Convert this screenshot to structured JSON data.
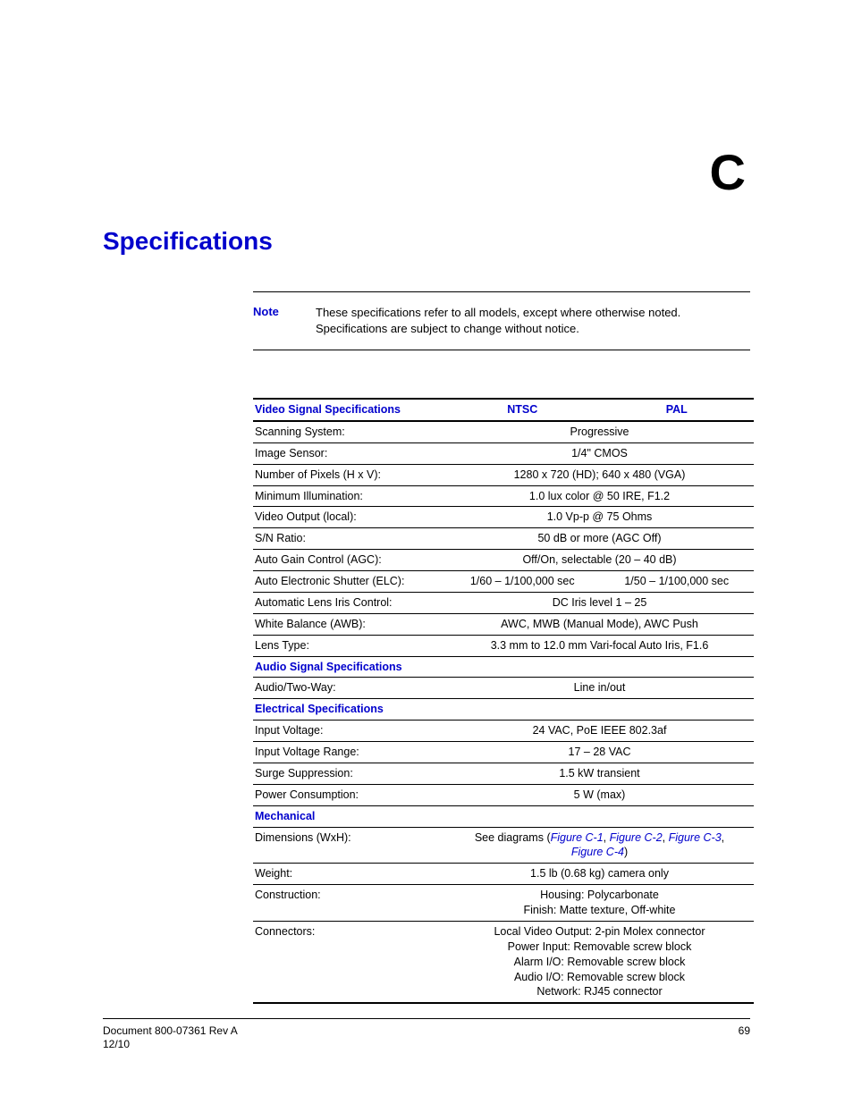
{
  "appendix_letter": "C",
  "title": "Specifications",
  "note": {
    "label": "Note",
    "text": "These specifications refer to all models, except where otherwise noted. Specifications are subject to change without notice."
  },
  "table": {
    "header": {
      "col1": "Video Signal Specifications",
      "col2": "NTSC",
      "col3": "PAL"
    },
    "rows": {
      "scanning_system": {
        "label": "Scanning System:",
        "value": "Progressive"
      },
      "image_sensor": {
        "label": "Image Sensor:",
        "value": "1/4\" CMOS"
      },
      "num_pixels": {
        "label": "Number of Pixels (H x V):",
        "value": "1280 x 720 (HD); 640 x 480 (VGA)"
      },
      "min_illum": {
        "label": "Minimum Illumination:",
        "value": "1.0 lux color @ 50 IRE, F1.2"
      },
      "video_output": {
        "label": "Video Output (local):",
        "value": "1.0 Vp-p @ 75 Ohms"
      },
      "sn_ratio": {
        "label": "S/N Ratio:",
        "value": "50 dB or more (AGC Off)"
      },
      "agc": {
        "label": "Auto Gain Control (AGC):",
        "value": "Off/On, selectable (20 – 40 dB)"
      },
      "elc": {
        "label": "Auto Electronic Shutter (ELC):",
        "ntsc": "1/60 – 1/100,000 sec",
        "pal": "1/50 – 1/100,000 sec"
      },
      "iris": {
        "label": "Automatic Lens Iris Control:",
        "value": "DC Iris level 1 – 25"
      },
      "awb": {
        "label": "White Balance (AWB):",
        "value": "AWC, MWB (Manual Mode), AWC Push"
      },
      "lens_type": {
        "label": "Lens Type:",
        "value": "3.3 mm to 12.0 mm Vari-focal Auto Iris, F1.6"
      },
      "audio_header": "Audio Signal Specifications",
      "audio_two_way": {
        "label": "Audio/Two-Way:",
        "value": "Line in/out"
      },
      "electrical_header": "Electrical Specifications",
      "input_voltage": {
        "label": "Input Voltage:",
        "value": "24 VAC, PoE IEEE 802.3af"
      },
      "input_voltage_range": {
        "label": "Input Voltage Range:",
        "value": "17 – 28 VAC"
      },
      "surge": {
        "label": "Surge Suppression:",
        "value": "1.5 kW transient"
      },
      "power": {
        "label": "Power Consumption:",
        "value": "5 W (max)"
      },
      "mechanical_header": "Mechanical",
      "dimensions": {
        "label": "Dimensions (WxH):",
        "prefix": "See diagrams (",
        "links": {
          "c1": "Figure C-1",
          "c2": "Figure C-2",
          "c3": "Figure C-3",
          "c4": "Figure C-4"
        },
        "sep": ", ",
        "suffix": ")"
      },
      "weight": {
        "label": "Weight:",
        "value": "1.5 lb (0.68 kg) camera only"
      },
      "construction": {
        "label": "Construction:",
        "line1": "Housing: Polycarbonate",
        "line2": "Finish: Matte texture, Off-white"
      },
      "connectors": {
        "label": "Connectors:",
        "line1": "Local Video Output: 2-pin Molex connector",
        "line2": "Power Input: Removable screw block",
        "line3": "Alarm I/O: Removable screw block",
        "line4": "Audio I/O: Removable screw block",
        "line5": "Network: RJ45 connector"
      }
    }
  },
  "footer": {
    "doc": "Document 800-07361 Rev A",
    "date": "12/10",
    "page": "69"
  }
}
